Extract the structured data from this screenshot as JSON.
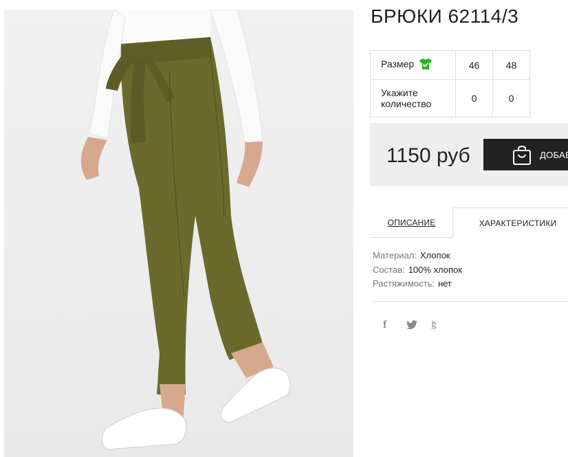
{
  "product": {
    "title": "БРЮКИ 62114/3"
  },
  "sizes": {
    "size_label": "Размер",
    "size_icon": "tshirt-check-icon",
    "quantity_label_line1": "Укажите",
    "quantity_label_line2": "количество",
    "columns": [
      {
        "size": "46",
        "quantity": "0"
      },
      {
        "size": "48",
        "quantity": "0"
      }
    ]
  },
  "buy": {
    "price": "1150 руб",
    "cart_label": "ДОБАВ",
    "cart_icon": "shopping-bag-icon",
    "button_color": "#222222"
  },
  "tabs": [
    {
      "label": "ОПИСАНИЕ"
    },
    {
      "label": "ХАРАКТЕРИСТИКИ"
    }
  ],
  "specs": [
    {
      "key": "Материал:",
      "value": "Хлопок"
    },
    {
      "key": "Состав:",
      "value": "100% хлопок"
    },
    {
      "key": "Растяжимость:",
      "value": "нет"
    }
  ],
  "social": {
    "facebook": "f",
    "twitter_icon": "twitter-icon",
    "googleplus": "g"
  },
  "colors": {
    "accent_green": "#1fb81f",
    "pants_olive": "#6b6a2c"
  }
}
